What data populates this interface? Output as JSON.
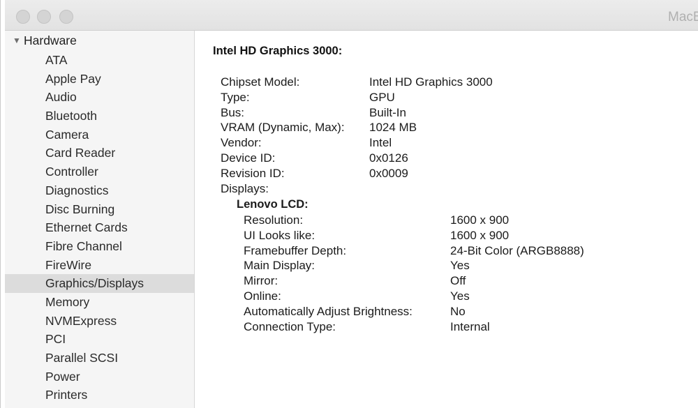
{
  "window": {
    "title": "MacB"
  },
  "sidebar": {
    "group_label": "Hardware",
    "items": [
      {
        "label": "ATA"
      },
      {
        "label": "Apple Pay"
      },
      {
        "label": "Audio"
      },
      {
        "label": "Bluetooth"
      },
      {
        "label": "Camera"
      },
      {
        "label": "Card Reader"
      },
      {
        "label": "Controller"
      },
      {
        "label": "Diagnostics"
      },
      {
        "label": "Disc Burning"
      },
      {
        "label": "Ethernet Cards"
      },
      {
        "label": "Fibre Channel"
      },
      {
        "label": "FireWire"
      },
      {
        "label": "Graphics/Displays"
      },
      {
        "label": "Memory"
      },
      {
        "label": "NVMExpress"
      },
      {
        "label": "PCI"
      },
      {
        "label": "Parallel SCSI"
      },
      {
        "label": "Power"
      },
      {
        "label": "Printers"
      }
    ],
    "selected": "Graphics/Displays"
  },
  "detail": {
    "title": "Intel HD Graphics 3000:",
    "rows": [
      {
        "key": "Chipset Model:",
        "value": "Intel HD Graphics 3000"
      },
      {
        "key": "Type:",
        "value": "GPU"
      },
      {
        "key": "Bus:",
        "value": "Built-In"
      },
      {
        "key": "VRAM (Dynamic, Max):",
        "value": "1024 MB"
      },
      {
        "key": "Vendor:",
        "value": "Intel"
      },
      {
        "key": "Device ID:",
        "value": "0x0126"
      },
      {
        "key": "Revision ID:",
        "value": "0x0009"
      },
      {
        "key": "Displays:",
        "value": ""
      }
    ],
    "display": {
      "title": "Lenovo LCD:",
      "rows": [
        {
          "key": "Resolution:",
          "value": "1600 x 900"
        },
        {
          "key": "UI Looks like:",
          "value": "1600 x 900"
        },
        {
          "key": "Framebuffer Depth:",
          "value": "24-Bit Color (ARGB8888)"
        },
        {
          "key": "Main Display:",
          "value": "Yes"
        },
        {
          "key": "Mirror:",
          "value": "Off"
        },
        {
          "key": "Online:",
          "value": "Yes"
        },
        {
          "key": "Automatically Adjust Brightness:",
          "value": "No"
        },
        {
          "key": "Connection Type:",
          "value": "Internal"
        }
      ]
    }
  }
}
